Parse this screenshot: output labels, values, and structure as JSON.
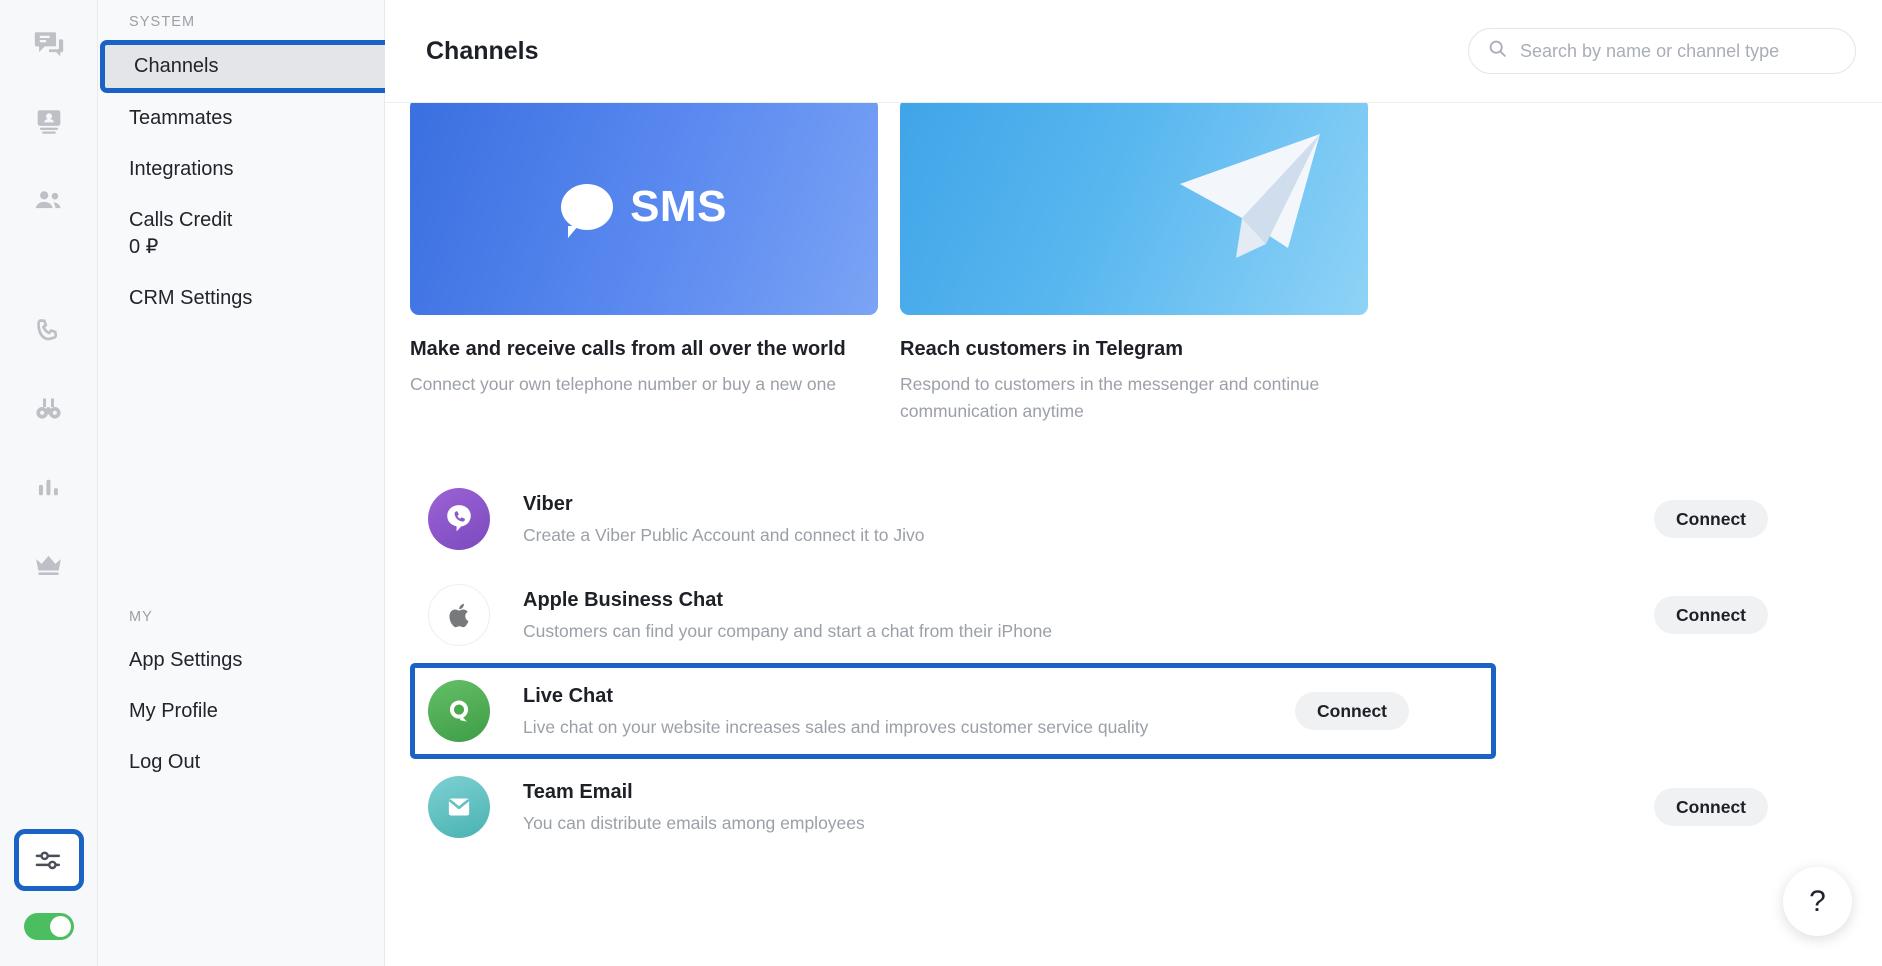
{
  "rail": {
    "top_icons": [
      {
        "name": "chats-icon",
        "glyph": "chats"
      },
      {
        "name": "contacts-icon",
        "glyph": "contacts"
      },
      {
        "name": "teammates-icon",
        "glyph": "teammates"
      }
    ],
    "mid_icons": [
      {
        "name": "phone-icon",
        "glyph": "phone"
      },
      {
        "name": "binoculars-icon",
        "glyph": "binoculars"
      },
      {
        "name": "analytics-icon",
        "glyph": "analytics"
      },
      {
        "name": "crown-icon",
        "glyph": "crown"
      }
    ],
    "settings_icon": {
      "name": "sliders-icon",
      "glyph": "sliders"
    },
    "status_toggle": {
      "name": "online-toggle",
      "state": "on"
    }
  },
  "sidebar": {
    "system_label": "SYSTEM",
    "system_items": [
      {
        "label": "Channels",
        "selected": true
      },
      {
        "label": "Teammates",
        "selected": false
      },
      {
        "label": "Integrations",
        "selected": false
      },
      {
        "label": "Calls Credit",
        "sub": "0 ₽",
        "selected": false
      },
      {
        "label": "CRM Settings",
        "selected": false
      }
    ],
    "my_label": "MY",
    "my_items": [
      {
        "label": "App Settings"
      },
      {
        "label": "My Profile"
      },
      {
        "label": "Log Out"
      }
    ]
  },
  "header": {
    "title": "Channels",
    "search": {
      "placeholder": "Search by name or channel type",
      "value": "",
      "icon": "search-icon"
    }
  },
  "promos": [
    {
      "id": "sms",
      "badge_text": "SMS",
      "title": "Make and receive calls from all over the world",
      "desc": "Connect your own telephone number or buy a new one"
    },
    {
      "id": "telegram",
      "badge_text": "",
      "title": "Reach customers in Telegram",
      "desc": "Respond to customers in the messenger and continue communication anytime"
    }
  ],
  "channels": [
    {
      "id": "viber",
      "icon": "viber-icon",
      "title": "Viber",
      "desc": "Create a Viber Public Account and connect it to Jivo",
      "button": "Connect",
      "highlighted": false
    },
    {
      "id": "apple-business-chat",
      "icon": "apple-icon",
      "title": "Apple Business Chat",
      "desc": "Customers can find your company and start a chat from their iPhone",
      "button": "Connect",
      "highlighted": false
    },
    {
      "id": "live-chat",
      "icon": "live-chat-icon",
      "title": "Live Chat",
      "desc": "Live chat on your website increases sales and improves customer service quality",
      "button": "Connect",
      "highlighted": true
    },
    {
      "id": "team-email",
      "icon": "email-icon",
      "title": "Team Email",
      "desc": "You can distribute emails among employees",
      "button": "Connect",
      "highlighted": false
    }
  ],
  "help": {
    "label": "?",
    "icon": "question-mark-icon"
  },
  "colors": {
    "highlight_blue": "#1a62c4",
    "accent_green": "#4bbf5f",
    "muted_text": "#9ba0a8",
    "selected_bg": "#e3e5e8"
  }
}
